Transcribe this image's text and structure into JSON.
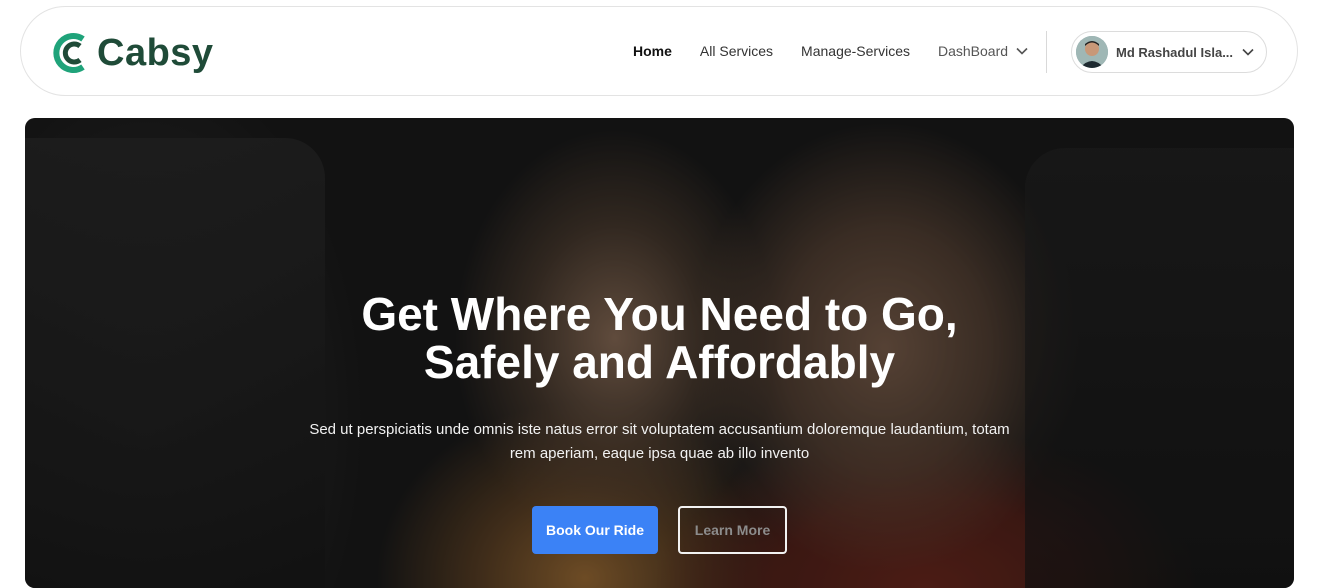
{
  "brand": {
    "name": "Cabsy",
    "color": "#1f4b38",
    "accent": "#1fa37a"
  },
  "nav": {
    "links": [
      {
        "label": "Home",
        "active": true
      },
      {
        "label": "All Services"
      },
      {
        "label": "Manage-Services"
      }
    ],
    "dashboard": {
      "label": "DashBoard",
      "icon": "chevron-down-icon"
    }
  },
  "user": {
    "name": "Md Rashadul Isla...",
    "icon": "chevron-down-icon"
  },
  "hero": {
    "title_line1": "Get Where You Need to Go,",
    "title_line2": "Safely and Affordably",
    "subtitle": "Sed ut perspiciatis unde omnis iste natus error sit voluptatem accusantium doloremque laudantium, totam rem aperiam, eaque ipsa quae ab illo invento",
    "primary_button": "Book Our Ride",
    "secondary_button": "Learn More",
    "primary_color": "#3b82f6"
  }
}
